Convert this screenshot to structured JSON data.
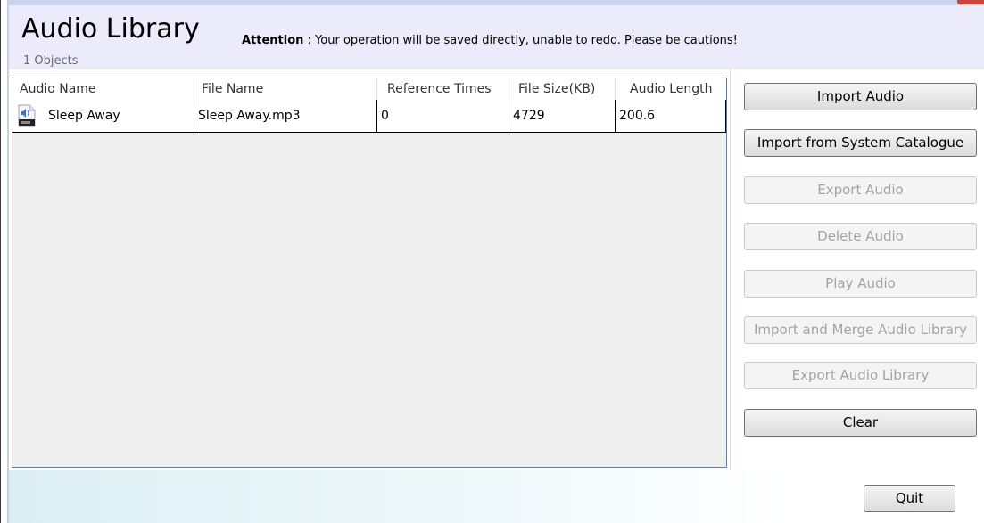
{
  "header": {
    "title": "Audio Library",
    "object_count": "1 Objects",
    "attention_label": "Attention",
    "attention_text": " : Your operation will be saved directly, unable to redo. Please be cautions!"
  },
  "table": {
    "columns": [
      "Audio Name",
      "File Name",
      "Reference Times",
      "File Size(KB)",
      "Audio Length"
    ],
    "rows": [
      {
        "audio_name": "Sleep Away",
        "file_name": "Sleep Away.mp3",
        "reference_times": "0",
        "file_size": "4729",
        "audio_length": "200.6",
        "icon": "audio-file-icon"
      }
    ]
  },
  "actions": {
    "import_audio": "Import Audio",
    "import_system": "Import from System Catalogue",
    "export_audio": "Export Audio",
    "delete_audio": "Delete Audio",
    "play_audio": "Play Audio",
    "import_merge": "Import and Merge Audio Library",
    "export_library": "Export Audio Library",
    "clear": "Clear"
  },
  "footer": {
    "quit": "Quit"
  },
  "colors": {
    "header_bg": "#ebebfc",
    "grid_bg": "#efefef",
    "disabled_text": "#a3a3a3"
  }
}
